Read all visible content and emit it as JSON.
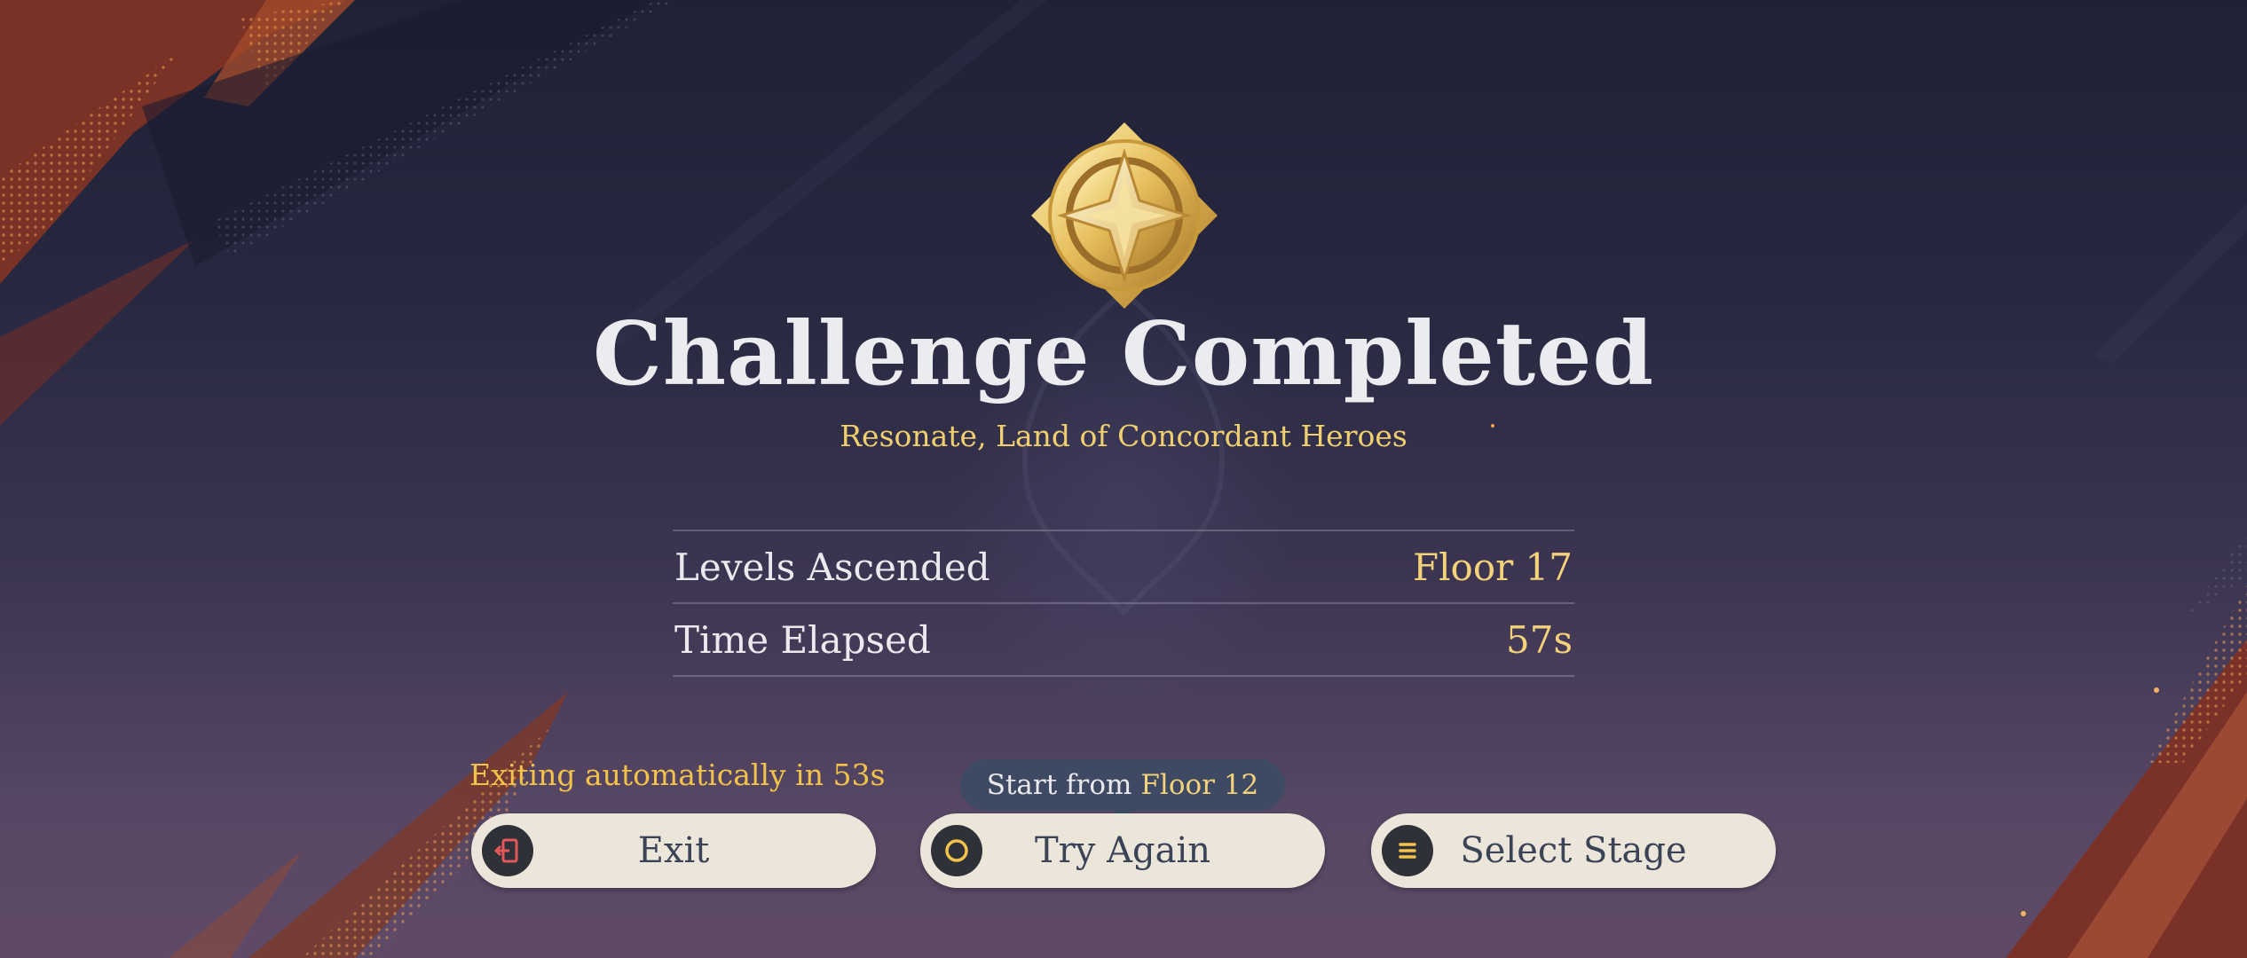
{
  "result": {
    "title": "Challenge Completed",
    "subtitle": "Resonate, Land of Concordant Heroes"
  },
  "stats": [
    {
      "label": "Levels Ascended",
      "value": "Floor 17"
    },
    {
      "label": "Time Elapsed",
      "value": "57s"
    }
  ],
  "auto_exit_text": "Exiting automatically in 53s",
  "tooltip": {
    "prefix": "Start from",
    "floor": "Floor 12"
  },
  "buttons": {
    "exit_label": "Exit",
    "try_again_label": "Try Again",
    "select_stage_label": "Select Stage"
  },
  "icons": {
    "emblem": "gold-star-medal-icon",
    "exit": "exit-door-icon",
    "try_again": "circle-button-icon",
    "select_stage": "menu-lines-icon"
  },
  "colors": {
    "title": "#ecebef",
    "accent_gold": "#f4d27a",
    "auto_exit": "#f2c24a",
    "button_bg": "#ece5da",
    "button_text": "#3b4457",
    "tooltip_bg": "#3e4a63",
    "exit_icon": "#e5585a",
    "icon_gold": "#f2c24a"
  }
}
